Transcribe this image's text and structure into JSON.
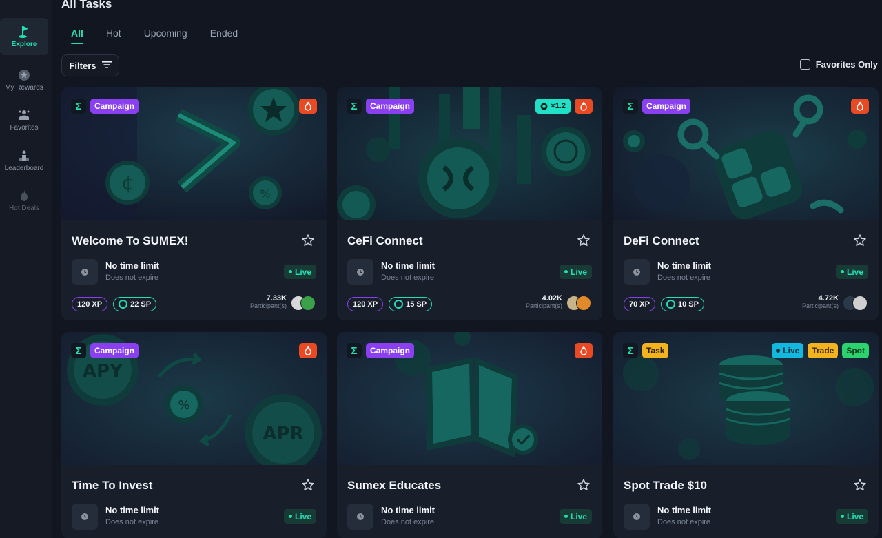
{
  "sidebar": {
    "items": [
      {
        "label": "Explore",
        "icon": "flag-icon"
      },
      {
        "label": "My Rewards",
        "icon": "star-coin-icon"
      },
      {
        "label": "Favorites",
        "icon": "favorites-icon"
      },
      {
        "label": "Leaderboard",
        "icon": "podium-icon"
      },
      {
        "label": "Hot Deals",
        "icon": "flame-icon"
      }
    ]
  },
  "header": {
    "title": "All Tasks",
    "tabs": [
      "All",
      "Hot",
      "Upcoming",
      "Ended"
    ],
    "filters_label": "Filters",
    "favorites_only_label": "Favorites Only"
  },
  "cards": [
    {
      "type_label": "Campaign",
      "title": "Welcome To SUMEX!",
      "limit_title": "No time limit",
      "limit_sub": "Does not expire",
      "status": "Live",
      "xp": "120 XP",
      "sp": "22 SP",
      "participants": "7.33K",
      "participants_label": "Participant(s)"
    },
    {
      "type_label": "Campaign",
      "multiplier": "×1.2",
      "title": "CeFi Connect",
      "limit_title": "No time limit",
      "limit_sub": "Does not expire",
      "status": "Live",
      "xp": "120 XP",
      "sp": "15 SP",
      "participants": "4.02K",
      "participants_label": "Participant(s)"
    },
    {
      "type_label": "Campaign",
      "title": "DeFi Connect",
      "limit_title": "No time limit",
      "limit_sub": "Does not expire",
      "status": "Live",
      "xp": "70 XP",
      "sp": "10 SP",
      "participants": "4.72K",
      "participants_label": "Participant(s)"
    },
    {
      "type_label": "Campaign",
      "title": "Time To Invest",
      "image_words": [
        "APY",
        "APR"
      ],
      "limit_title": "No time limit",
      "limit_sub": "Does not expire",
      "status": "Live"
    },
    {
      "type_label": "Campaign",
      "title": "Sumex Educates",
      "limit_title": "No time limit",
      "limit_sub": "Does not expire",
      "status": "Live"
    },
    {
      "type_label": "Task",
      "tags": [
        "Live",
        "Trade",
        "Spot"
      ],
      "title": "Spot Trade $10",
      "limit_title": "No time limit",
      "limit_sub": "Does not expire",
      "status": "Live"
    }
  ],
  "colors": {
    "accent": "#22e0b4",
    "campaign": "#8a3ff0",
    "task": "#f2b31f",
    "hot": "#ea4a23",
    "background": "#111620",
    "card": "#191f2a"
  }
}
